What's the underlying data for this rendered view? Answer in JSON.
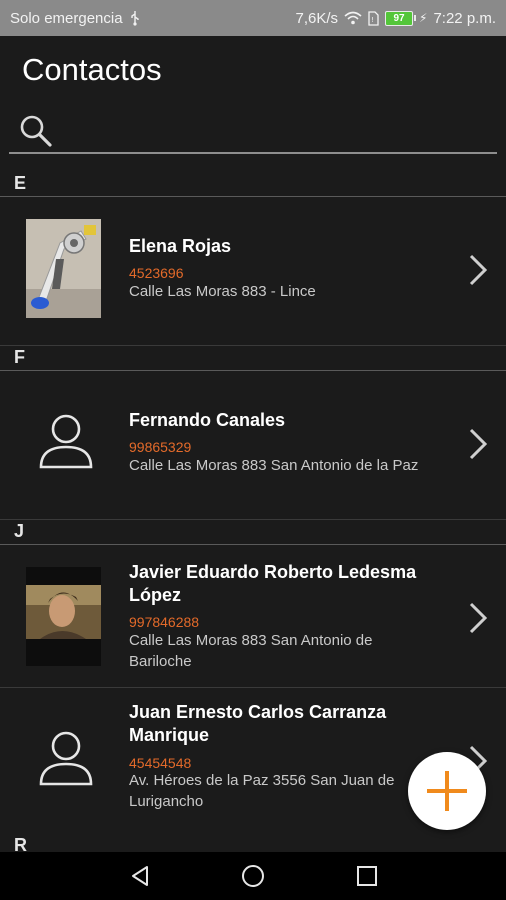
{
  "status_bar": {
    "carrier": "Solo emergencia",
    "usb_icon": "usb-icon",
    "speed": "7,6K/s",
    "wifi_icon": "wifi-icon",
    "sim_icon": "sim-icon",
    "battery_level": "97",
    "charging_icon": "bolt-icon",
    "time": "7:22 p.m."
  },
  "header": {
    "title": "Contactos"
  },
  "search": {
    "placeholder": "",
    "value": "",
    "icon": "search-icon"
  },
  "sections": [
    {
      "letter": "E",
      "contacts": [
        {
          "name": "Elena Rojas",
          "phone": "4523696",
          "address": "Calle Las Moras 883 - Lince",
          "avatar": "photo"
        }
      ]
    },
    {
      "letter": "F",
      "contacts": [
        {
          "name": "Fernando Canales",
          "phone": "99865329",
          "address": "Calle Las Moras 883 San Antonio de la Paz",
          "avatar": "person-icon"
        }
      ]
    },
    {
      "letter": "J",
      "contacts": [
        {
          "name": "Javier Eduardo Roberto Ledesma López",
          "phone": "997846288",
          "address": "Calle Las Moras 883 San Antonio de Bariloche",
          "avatar": "photo"
        },
        {
          "name": "Juan Ernesto Carlos Carranza Manrique",
          "phone": "45454548",
          "address": "Av. Héroes de la Paz 3556 San Juan de Lurigancho",
          "avatar": "person-icon"
        }
      ]
    },
    {
      "letter": "R",
      "contacts": []
    }
  ],
  "fab": {
    "icon": "plus-icon",
    "color": "#f08a1c"
  },
  "colors": {
    "background": "#1b1b1b",
    "phone": "#e36a2a",
    "status_bar": "#8a8a8a"
  },
  "nav": {
    "back": "back-icon",
    "home": "home-icon",
    "recents": "recents-icon"
  }
}
